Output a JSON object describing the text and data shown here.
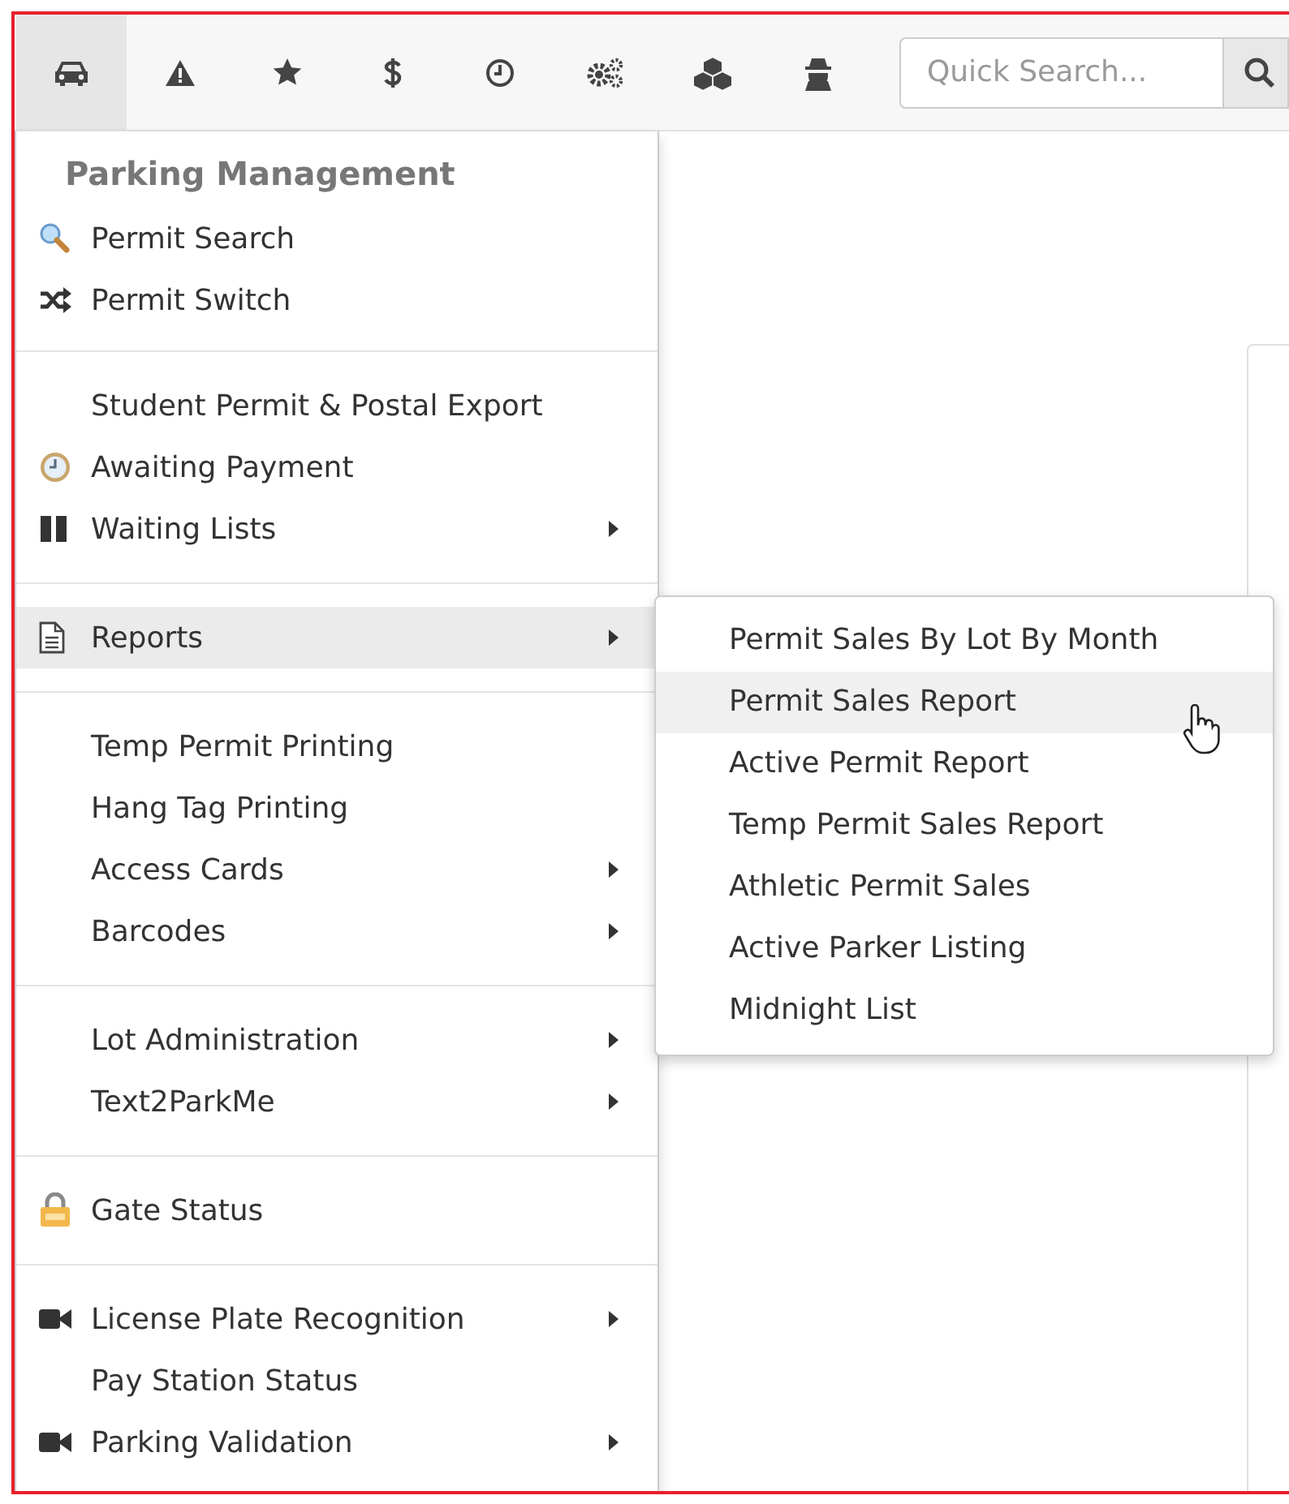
{
  "toolbar": {
    "tools": [
      {
        "kind": "car",
        "selected": true
      },
      {
        "kind": "warning",
        "selected": false
      },
      {
        "kind": "star",
        "selected": false
      },
      {
        "kind": "dollar",
        "selected": false
      },
      {
        "kind": "clock",
        "selected": false
      },
      {
        "kind": "gears",
        "selected": false
      },
      {
        "kind": "cubes",
        "selected": false
      },
      {
        "kind": "spy",
        "selected": false
      }
    ],
    "search": {
      "placeholder": "Quick Search..."
    }
  },
  "menu": {
    "title": "Parking Management",
    "sections": [
      {
        "items": [
          {
            "label": "Permit Search",
            "kind": "magnifier",
            "submenu": false,
            "selected": false
          },
          {
            "label": "Permit Switch",
            "kind": "shuffle",
            "submenu": false,
            "selected": false
          }
        ]
      },
      {
        "items": [
          {
            "label": "Student Permit & Postal Export",
            "submenu": false,
            "selected": false
          },
          {
            "label": "Awaiting Payment",
            "kind": "clock",
            "submenu": false,
            "selected": false
          },
          {
            "label": "Waiting Lists",
            "kind": "pause",
            "submenu": true,
            "selected": false
          }
        ]
      },
      {
        "items": [
          {
            "label": "Reports",
            "kind": "document",
            "submenu": true,
            "selected": true
          }
        ]
      },
      {
        "items": [
          {
            "label": "Temp Permit Printing",
            "submenu": false,
            "selected": false
          },
          {
            "label": "Hang Tag Printing",
            "submenu": false,
            "selected": false
          },
          {
            "label": "Access Cards",
            "submenu": true,
            "selected": false
          },
          {
            "label": "Barcodes",
            "submenu": true,
            "selected": false
          }
        ]
      },
      {
        "items": [
          {
            "label": "Lot Administration",
            "submenu": true,
            "selected": false
          },
          {
            "label": "Text2ParkMe",
            "submenu": true,
            "selected": false
          }
        ]
      },
      {
        "items": [
          {
            "label": "Gate Status",
            "kind": "padlock",
            "submenu": false,
            "selected": false
          }
        ]
      },
      {
        "items": [
          {
            "label": "License Plate Recognition",
            "kind": "camera",
            "submenu": true,
            "selected": false
          },
          {
            "label": "Pay Station Status",
            "submenu": false,
            "selected": false
          },
          {
            "label": "Parking Validation",
            "kind": "camera",
            "submenu": true,
            "selected": false
          }
        ]
      }
    ]
  },
  "submenu": {
    "items": [
      {
        "label": "Permit Sales By Lot By Month",
        "selected": false
      },
      {
        "label": "Permit Sales Report",
        "selected": true
      },
      {
        "label": "Active Permit Report",
        "selected": false
      },
      {
        "label": "Temp Permit Sales Report",
        "selected": false
      },
      {
        "label": "Athletic Permit Sales",
        "selected": false
      },
      {
        "label": "Active Parker Listing",
        "selected": false
      },
      {
        "label": "Midnight List",
        "selected": false
      }
    ]
  }
}
